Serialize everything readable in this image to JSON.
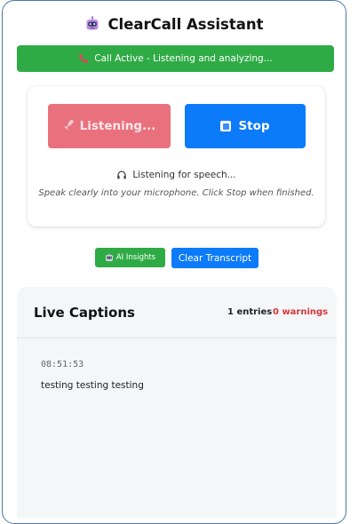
{
  "header": {
    "title": "ClearCall Assistant",
    "icon": "robot-icon"
  },
  "status_bar": {
    "text": "Call Active - Listening and analyzing...",
    "icon": "phone-icon",
    "color": "#2fab46"
  },
  "controls": {
    "listening_label": "Listening...",
    "listening_icon": "microphone-icon",
    "listening_color": "#e8717d",
    "stop_label": "Stop",
    "stop_icon": "stop-icon",
    "stop_color": "#0c7bfa",
    "status_text": "Listening for speech...",
    "status_icon": "headphones-icon",
    "hint_text": "Speak clearly into your microphone. Click Stop when finished."
  },
  "actions": {
    "insights_label": "AI Insights",
    "insights_icon": "robot-icon",
    "clear_label": "Clear Transcript"
  },
  "captions": {
    "title": "Live Captions",
    "entries_count": "1 entries",
    "warnings_count": "0 warnings",
    "warnings_color": "#d9363e",
    "entries": [
      {
        "time": "08:51:53",
        "text": "testing testing testing"
      }
    ]
  }
}
